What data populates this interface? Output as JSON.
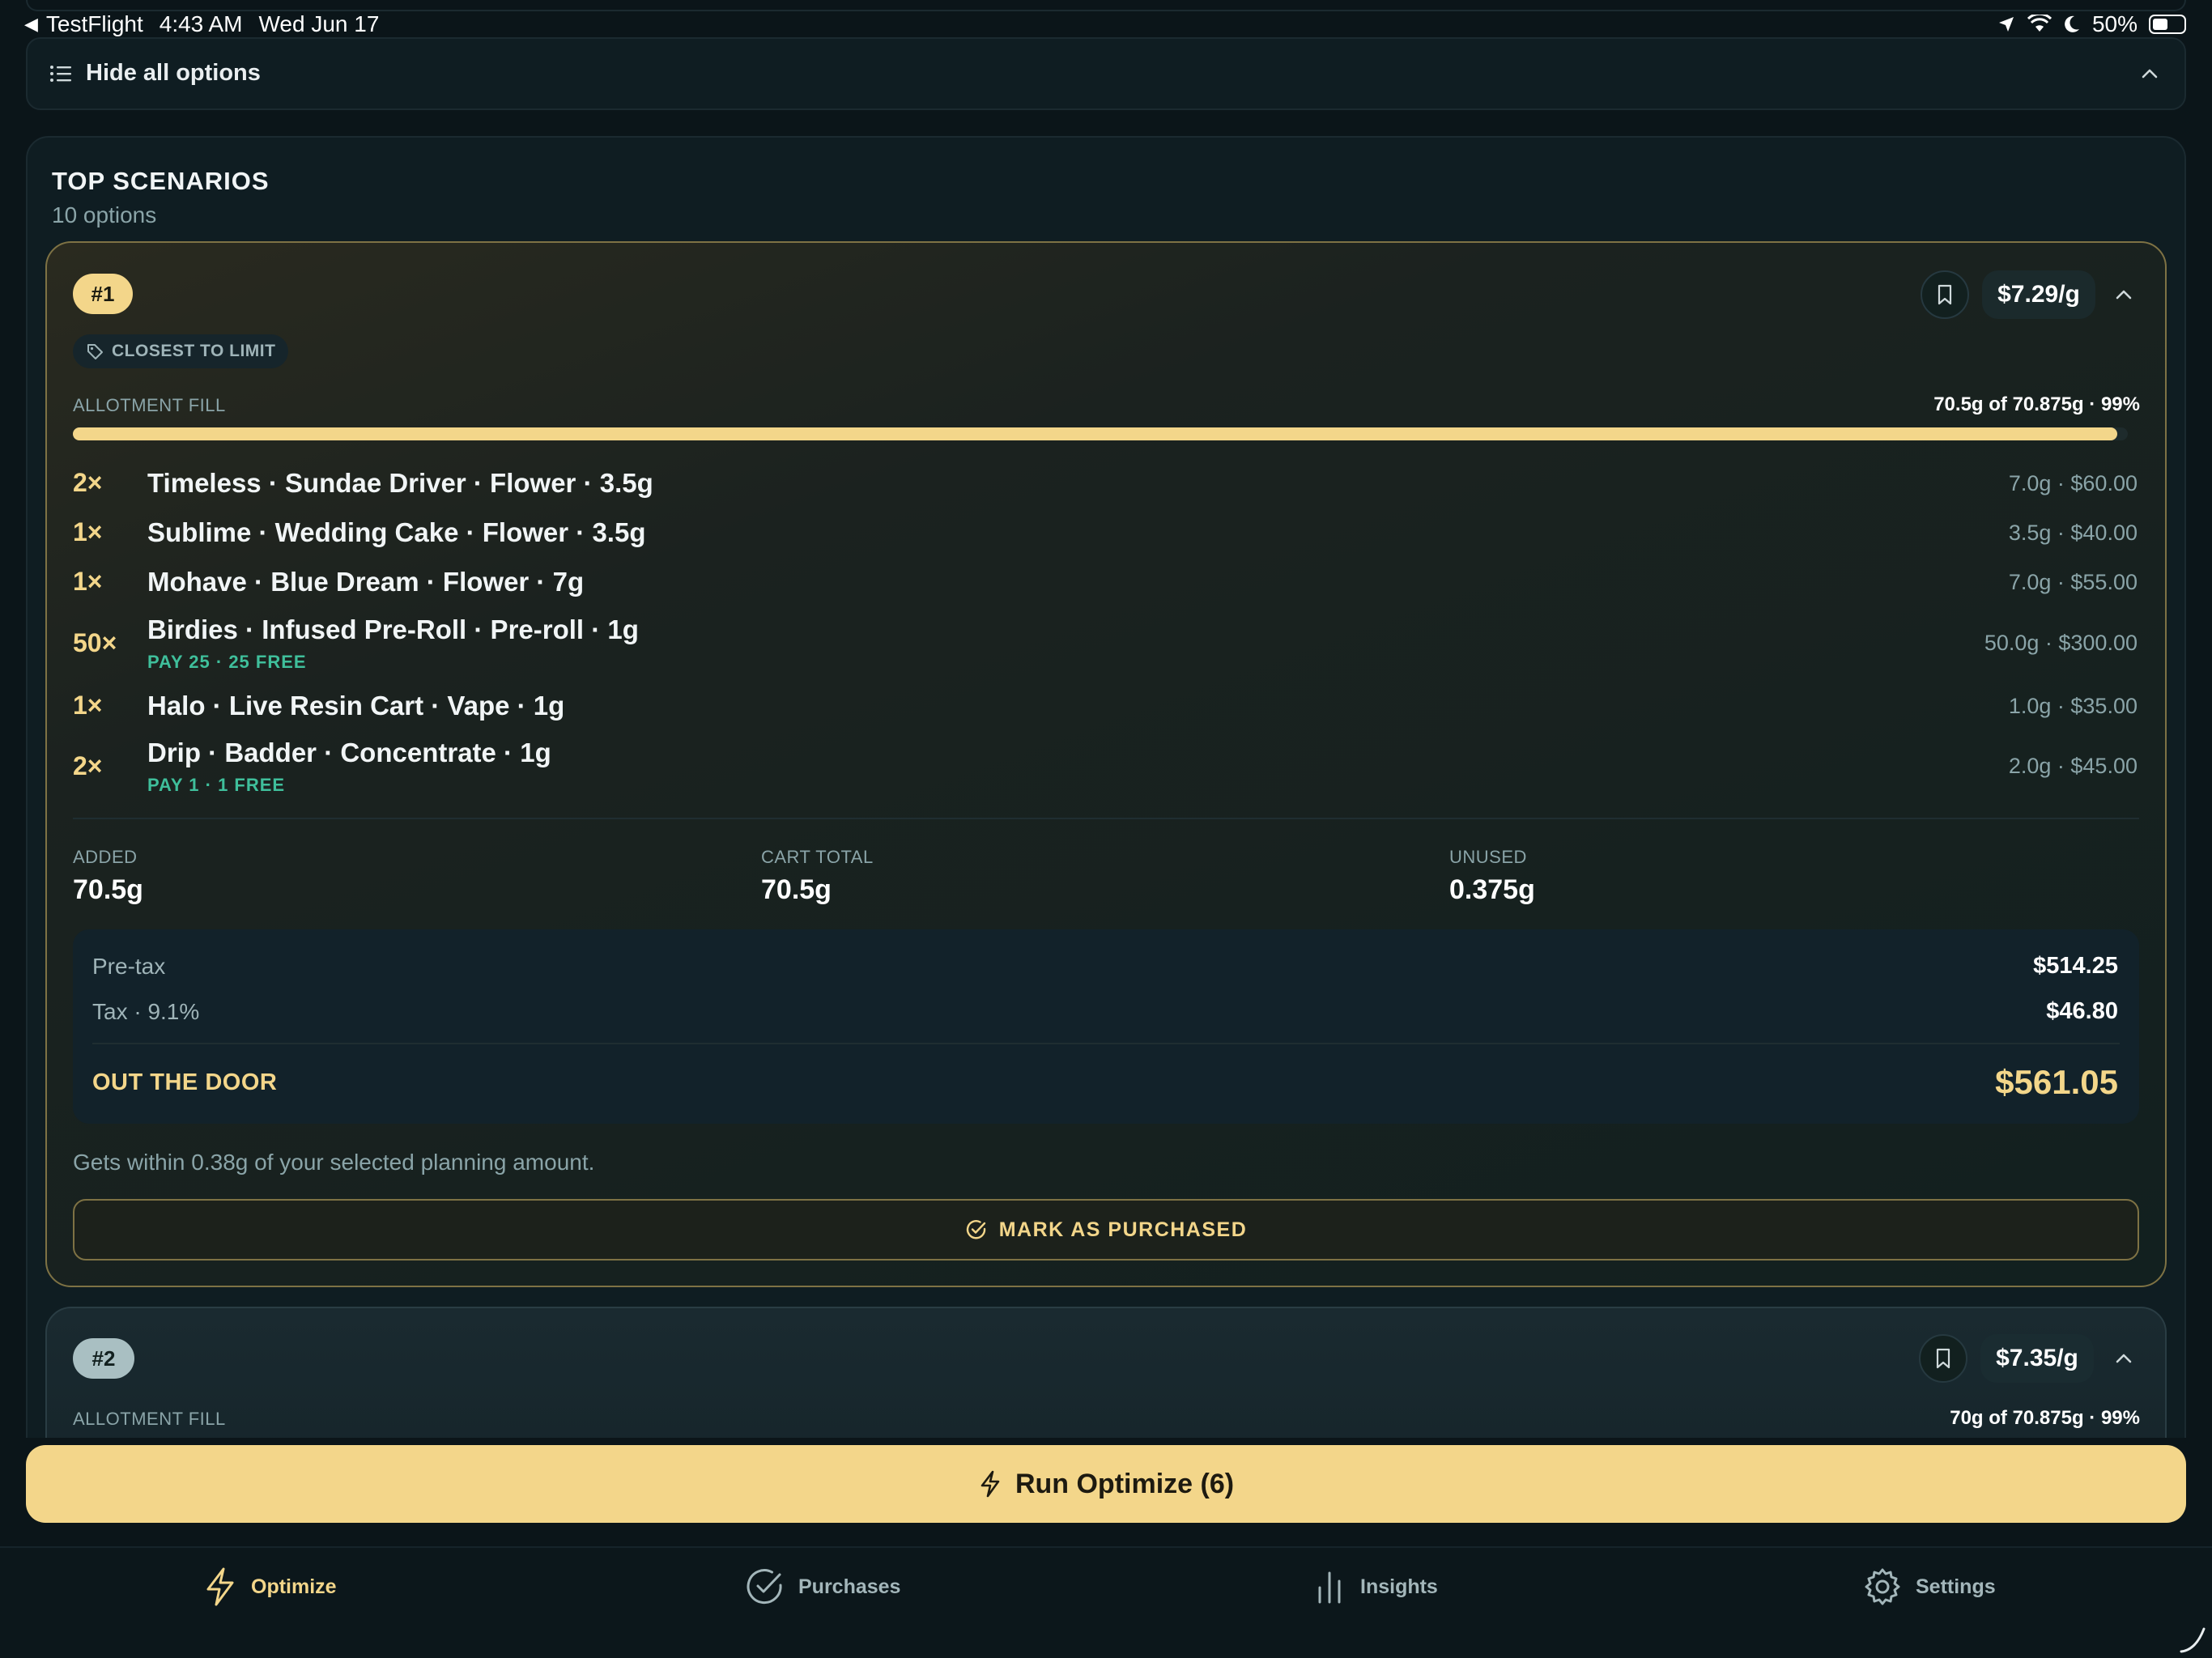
{
  "status_bar": {
    "back_app": "TestFlight",
    "time": "4:43 AM",
    "date": "Wed Jun 17",
    "battery": "50%"
  },
  "options_bar": {
    "label": "Hide all options",
    "icon": "list-icon"
  },
  "scenarios": {
    "title": "TOP SCENARIOS",
    "subtitle": "10 options"
  },
  "scenario1": {
    "rank": "#1",
    "tag": "CLOSEST TO LIMIT",
    "price_per_gram": "$7.29/g",
    "fill_label": "ALLOTMENT FILL",
    "fill_value": "70.5g of 70.875g · 99%",
    "fill_fraction": 0.995,
    "items": [
      {
        "qty": "2×",
        "name": "Timeless · Sundae Driver · Flower · 3.5g",
        "deal": "",
        "right": "7.0g · $60.00"
      },
      {
        "qty": "1×",
        "name": "Sublime · Wedding Cake · Flower · 3.5g",
        "deal": "",
        "right": "3.5g · $40.00"
      },
      {
        "qty": "1×",
        "name": "Mohave · Blue Dream · Flower · 7g",
        "deal": "",
        "right": "7.0g · $55.00"
      },
      {
        "qty": "50×",
        "name": "Birdies · Infused Pre-Roll · Pre-roll · 1g",
        "deal": "PAY 25 · 25 FREE",
        "right": "50.0g · $300.00"
      },
      {
        "qty": "1×",
        "name": "Halo · Live Resin Cart · Vape · 1g",
        "deal": "",
        "right": "1.0g · $35.00"
      },
      {
        "qty": "2×",
        "name": "Drip · Badder · Concentrate · 1g",
        "deal": "PAY 1 · 1 FREE",
        "right": "2.0g · $45.00"
      }
    ],
    "stats": {
      "added_label": "ADDED",
      "added_value": "70.5g",
      "cart_label": "CART TOTAL",
      "cart_value": "70.5g",
      "unused_label": "UNUSED",
      "unused_value": "0.375g"
    },
    "totals": {
      "pretax_label": "Pre-tax",
      "pretax_value": "$514.25",
      "tax_label": "Tax · 9.1%",
      "tax_value": "$46.80",
      "otd_label": "OUT THE DOOR",
      "otd_value": "$561.05"
    },
    "note": "Gets within 0.38g of your selected planning amount.",
    "purchase_label": "MARK AS PURCHASED"
  },
  "scenario2": {
    "rank": "#2",
    "price_per_gram": "$7.35/g",
    "fill_label": "ALLOTMENT FILL",
    "fill_value": "70g of 70.875g · 99%"
  },
  "run_button": {
    "label": "Run Optimize (6)"
  },
  "tabs": [
    {
      "label": "Optimize",
      "icon": "bolt-icon",
      "active": true
    },
    {
      "label": "Purchases",
      "icon": "check-circle-icon",
      "active": false
    },
    {
      "label": "Insights",
      "icon": "bar-chart-icon",
      "active": false
    },
    {
      "label": "Settings",
      "icon": "gear-icon",
      "active": false
    }
  ],
  "colors": {
    "background": "#0b1519",
    "accent": "#f3d68a",
    "deal_green": "#3fbf9b",
    "muted_text": "#8aa4a8"
  }
}
